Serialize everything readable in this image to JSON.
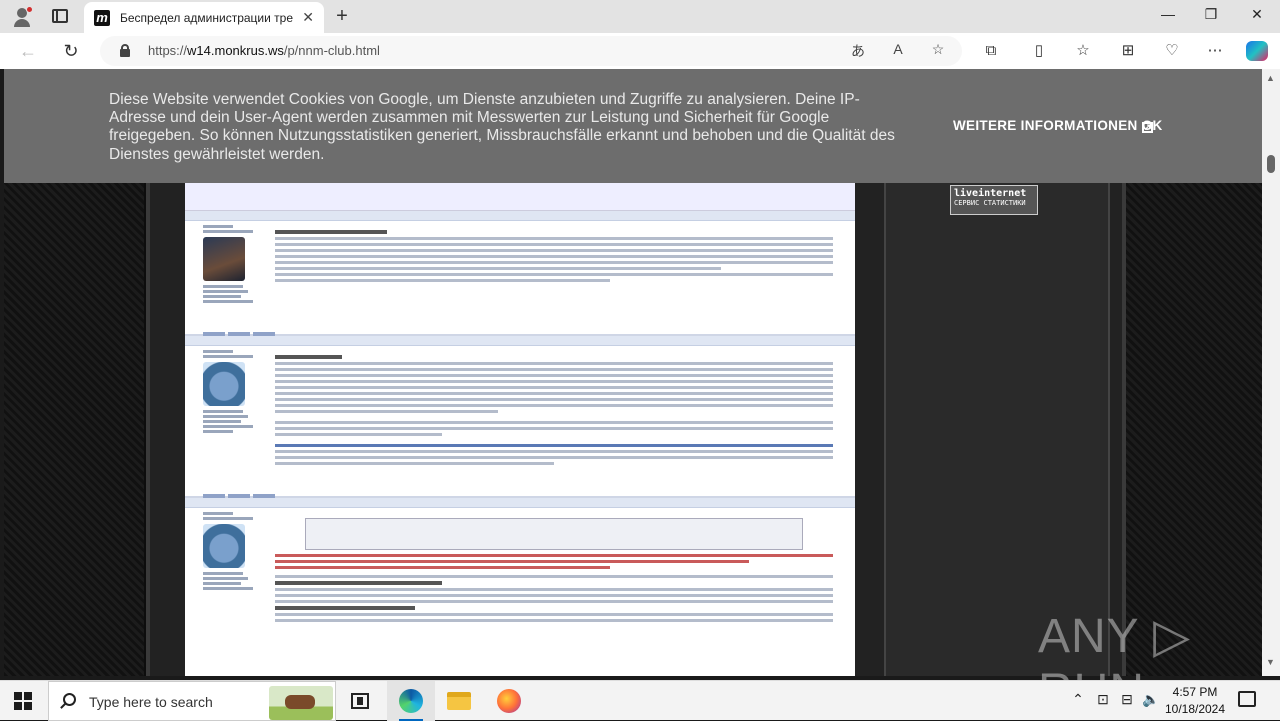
{
  "browser": {
    "tab_title": "Беспредел администрации тре",
    "tab_favicon": "m",
    "new_tab_label": "+",
    "url_prefix": "https://",
    "url_domain": "w14.monkrus.ws",
    "url_path": "/p/nnm-club.html",
    "window_controls": {
      "minimize": "—",
      "maximize": "❐",
      "close": "✕"
    }
  },
  "cookie_banner": {
    "text": "Diese Website verwendet Cookies von Google, um Dienste anzubieten und Zugriffe zu analysieren. Deine IP-Adresse und dein User-Agent werden zusammen mit Messwerten zur Leistung und Sicherheit für Google freigegeben. So können Nutzungsstatistiken generiert, Missbrauchsfälle erkannt und behoben und die Qualität des Dienstes gewährleistet werden.",
    "more_info": "WEITERE INFORMATIONEN",
    "ok": "OK"
  },
  "page": {
    "counter_line1": "liveinternet",
    "counter_line2": "СЕРВИС СТАТИСТИКИ"
  },
  "watermark": "ANY ▷ RUN",
  "taskbar": {
    "search_placeholder": "Type here to search",
    "time": "4:57 PM",
    "date": "10/18/2024"
  }
}
